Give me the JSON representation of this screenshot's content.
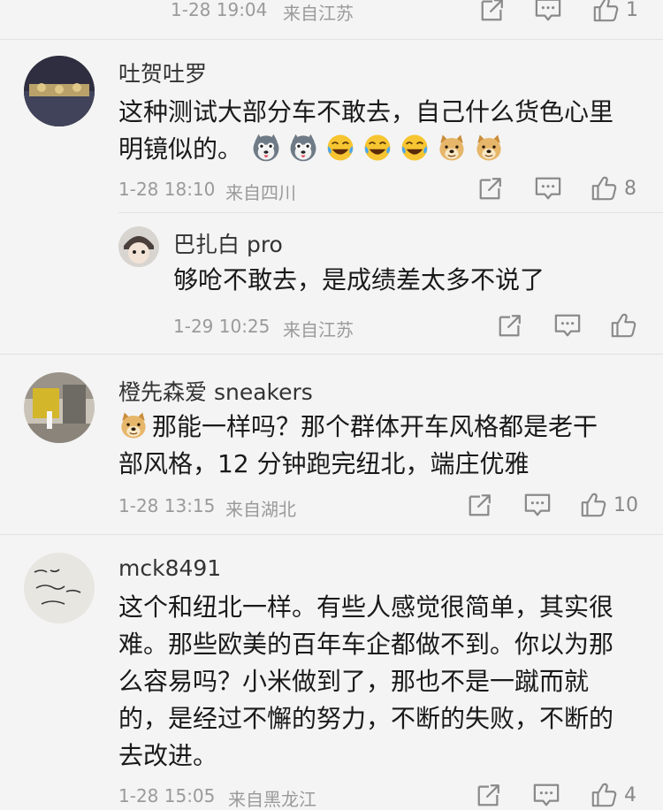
{
  "colors": {
    "background": "#f4f4f4",
    "meta": "#9a9a9a",
    "icon": "#8a8a8a"
  },
  "top_meta": {
    "date": "1-28 19:04",
    "location": "来自江苏",
    "likes": "1"
  },
  "comments": [
    {
      "user": "吐贺吐罗",
      "text_line1": "这种测试大部分车不敢去，自己什么货色心里",
      "text_line2": "明镜似的。",
      "emojis": [
        "husky-emoji",
        "husky-emoji",
        "laugh-cry-emoji",
        "laugh-cry-emoji",
        "laugh-cry-emoji",
        "doge-emoji",
        "doge-emoji"
      ],
      "date": "1-28 18:10",
      "location": "来自四川",
      "likes": "8"
    },
    {
      "user": "巴扎白 pro",
      "text": "够呛不敢去，是成绩差太多不说了",
      "date": "1-29 10:25",
      "location": "来自江苏",
      "likes": ""
    },
    {
      "user": "橙先森爱 sneakers",
      "emoji": "doge-emoji",
      "text_line1": "那能一样吗？那个群体开车风格都是老干",
      "text_line2": "部风格，12 分钟跑完纽北，端庄优雅",
      "date": "1-28 13:15",
      "location": "来自湖北",
      "likes": "10"
    },
    {
      "user": "mck8491",
      "text_lines": [
        "这个和纽北一样。有些人感觉很简单，其实很",
        "难。那些欧美的百年车企都做不到。你以为那",
        "么容易吗？小米做到了，那也不是一蹴而就",
        "的，是经过不懈的努力，不断的失败，不断的",
        "去改进。"
      ],
      "date": "1-28 15:05",
      "location": "来自黑龙江",
      "likes": "4"
    }
  ]
}
